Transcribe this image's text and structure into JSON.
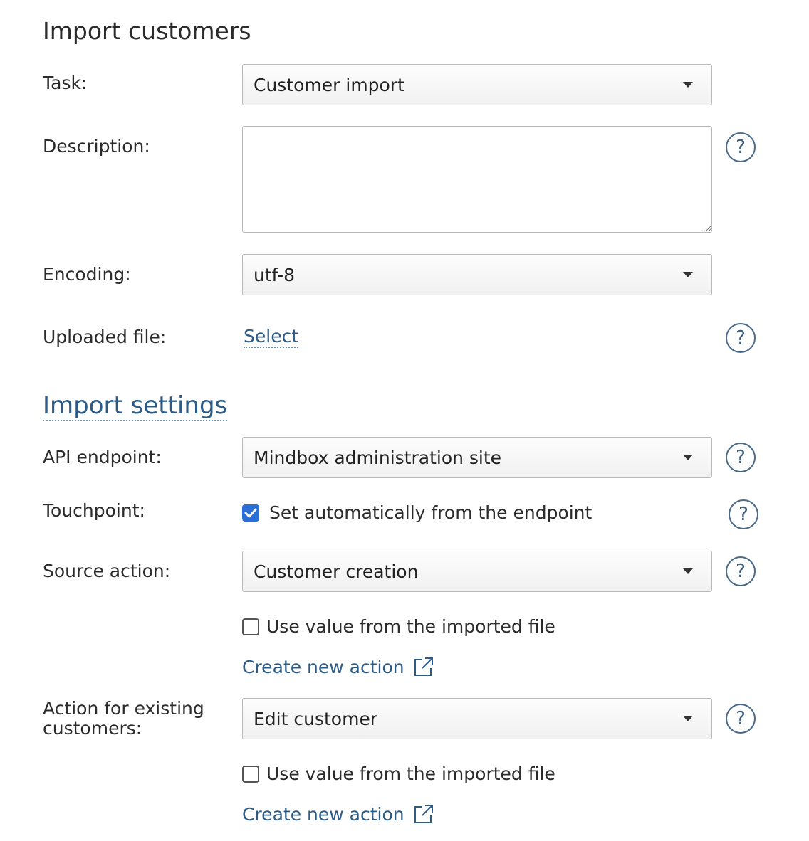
{
  "page": {
    "title": "Import customers"
  },
  "form": {
    "task": {
      "label": "Task:",
      "value": "Customer import"
    },
    "description": {
      "label": "Description:",
      "value": ""
    },
    "encoding": {
      "label": "Encoding:",
      "value": "utf-8"
    },
    "uploaded_file": {
      "label": "Uploaded file:",
      "link": "Select"
    }
  },
  "settings": {
    "title": "Import settings",
    "api_endpoint": {
      "label": "API endpoint:",
      "value": "Mindbox administration site"
    },
    "touchpoint": {
      "label": "Touchpoint:",
      "checkbox_label": "Set automatically from the endpoint",
      "checked": true
    },
    "source_action": {
      "label": "Source action:",
      "value": "Customer creation",
      "checkbox_label": "Use value from the imported file",
      "checked": false,
      "create_link": "Create new action"
    },
    "existing_action": {
      "label": "Action for existing customers:",
      "value": "Edit customer",
      "checkbox_label": "Use value from the imported file",
      "checked": false,
      "create_link": "Create new action"
    }
  },
  "icons": {
    "help": "?",
    "dropdown": "caret-down-icon",
    "external": "external-link-icon",
    "check": "checkmark-icon"
  },
  "colors": {
    "link": "#2c5b86",
    "help_icon": "#4a6b8a",
    "checkbox_checked": "#2a6fd6",
    "border": "#b9b9b9"
  }
}
